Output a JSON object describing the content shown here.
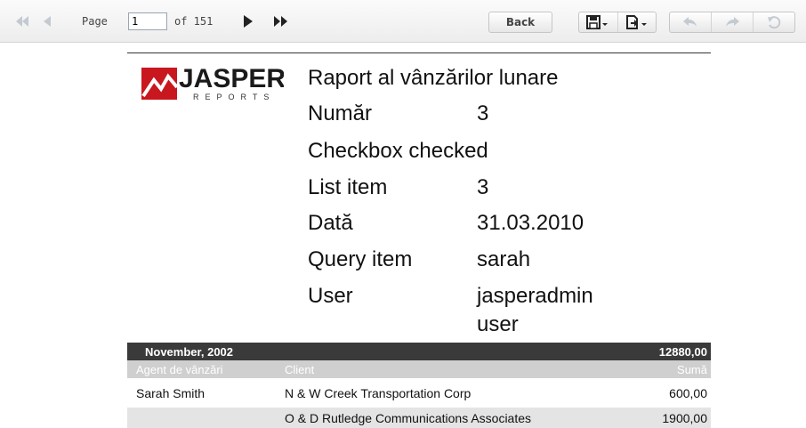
{
  "toolbar": {
    "page_label": "Page",
    "page_value": "1",
    "of_label": "of 151",
    "back_label": "Back"
  },
  "report": {
    "logo": {
      "main": "JASPER",
      "sub": "REPORTS"
    },
    "title": "Raport al vânzărilor lunare",
    "fields": {
      "number_label": "Număr",
      "number_value": "3",
      "checkbox_label": "Checkbox checked",
      "list_label": "List item",
      "list_value": "3",
      "date_label": "Dată",
      "date_value": "31.03.2010",
      "query_label": "Query item",
      "query_value": "sarah",
      "user_label": "User",
      "user_value_1": "jasperadmin",
      "user_value_2": "user"
    },
    "group": {
      "month": "November, 2002",
      "total": "12880,00"
    },
    "columns": {
      "agent": "Agent de vânzări",
      "client": "Client",
      "sum": "Sumă"
    },
    "rows": [
      {
        "agent": "Sarah Smith",
        "client": "N & W Creek Transportation Corp",
        "sum": "600,00"
      },
      {
        "agent": "",
        "client": "O & D Rutledge Communications Associates",
        "sum": "1900,00"
      }
    ]
  },
  "colors": {
    "logo_red": "#c8171e",
    "band_dark": "#3a3a3a",
    "band_gray": "#cfcfcf",
    "row_alt": "#e4e4e4"
  }
}
